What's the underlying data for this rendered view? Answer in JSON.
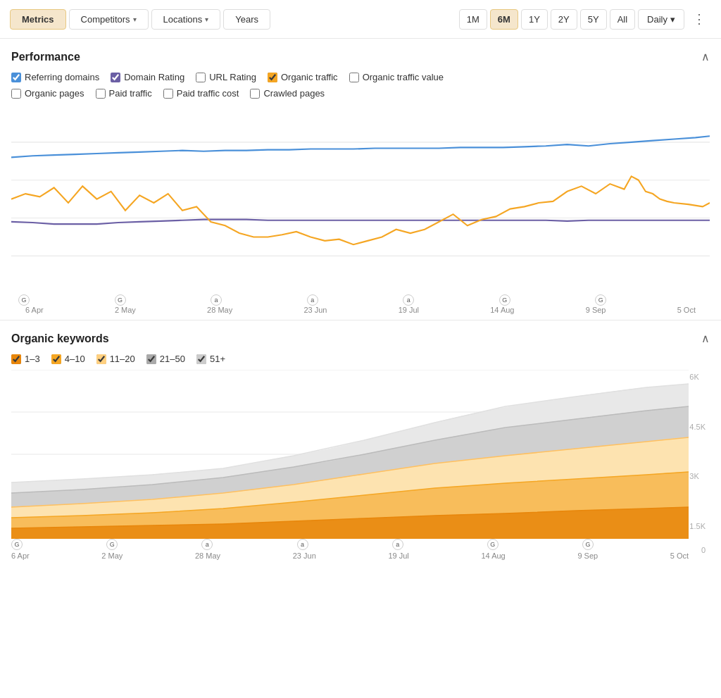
{
  "toolbar": {
    "metrics_label": "Metrics",
    "competitors_label": "Competitors",
    "locations_label": "Locations",
    "years_label": "Years",
    "time_buttons": [
      "1M",
      "6M",
      "1Y",
      "2Y",
      "5Y",
      "All"
    ],
    "active_time": "6M",
    "frequency_label": "Daily",
    "more_icon": "⋮"
  },
  "performance": {
    "title": "Performance",
    "checkboxes_row1": [
      {
        "id": "referring_domains",
        "label": "Referring domains",
        "checked": true,
        "color": "blue"
      },
      {
        "id": "domain_rating",
        "label": "Domain Rating",
        "checked": true,
        "color": "purple"
      },
      {
        "id": "url_rating",
        "label": "URL Rating",
        "checked": false,
        "color": "none"
      },
      {
        "id": "organic_traffic",
        "label": "Organic traffic",
        "checked": true,
        "color": "orange"
      },
      {
        "id": "organic_traffic_value",
        "label": "Organic traffic value",
        "checked": false,
        "color": "none"
      }
    ],
    "checkboxes_row2": [
      {
        "id": "organic_pages",
        "label": "Organic pages",
        "checked": false,
        "color": "none"
      },
      {
        "id": "paid_traffic",
        "label": "Paid traffic",
        "checked": false,
        "color": "none"
      },
      {
        "id": "paid_traffic_cost",
        "label": "Paid traffic cost",
        "checked": false,
        "color": "none"
      },
      {
        "id": "crawled_pages",
        "label": "Crawled pages",
        "checked": false,
        "color": "none"
      }
    ],
    "x_labels": [
      "6 Apr",
      "2 May",
      "28 May",
      "23 Jun",
      "19 Jul",
      "14 Aug",
      "9 Sep",
      "5 Oct"
    ],
    "annotations": [
      {
        "x_label": "6 Apr",
        "badge": "G"
      },
      {
        "x_label": "2 May",
        "badge": "G"
      },
      {
        "x_label": "28 May",
        "badge": "a"
      },
      {
        "x_label": "23 Jun",
        "badge": "a"
      },
      {
        "x_label": "19 Jul",
        "badge": "a"
      },
      {
        "x_label": "14 Aug",
        "badge": "G"
      },
      {
        "x_label": "9 Sep",
        "badge": "G"
      },
      {
        "x_label": "5 Oct",
        "badge": ""
      }
    ]
  },
  "organic_keywords": {
    "title": "Organic keywords",
    "checkboxes": [
      {
        "id": "pos1_3",
        "label": "1–3",
        "checked": true,
        "color": "orange_dark"
      },
      {
        "id": "pos4_10",
        "label": "4–10",
        "checked": true,
        "color": "orange"
      },
      {
        "id": "pos11_20",
        "label": "11–20",
        "checked": true,
        "color": "orange_light"
      },
      {
        "id": "pos21_50",
        "label": "21–50",
        "checked": true,
        "color": "gray_medium"
      },
      {
        "id": "pos51plus",
        "label": "51+",
        "checked": true,
        "color": "gray_light"
      }
    ],
    "y_labels": [
      "6K",
      "4.5K",
      "3K",
      "1.5K",
      "0"
    ],
    "x_labels": [
      "6 Apr",
      "2 May",
      "28 May",
      "23 Jun",
      "19 Jul",
      "14 Aug",
      "9 Sep",
      "5 Oct"
    ],
    "annotations": [
      {
        "x_label": "6 Apr",
        "badge": "G"
      },
      {
        "x_label": "2 May",
        "badge": "G"
      },
      {
        "x_label": "28 May",
        "badge": "a"
      },
      {
        "x_label": "23 Jun",
        "badge": "a"
      },
      {
        "x_label": "19 Jul",
        "badge": "a"
      },
      {
        "x_label": "14 Aug",
        "badge": "G"
      },
      {
        "x_label": "9 Sep",
        "badge": "G"
      },
      {
        "x_label": "5 Oct",
        "badge": ""
      }
    ]
  }
}
